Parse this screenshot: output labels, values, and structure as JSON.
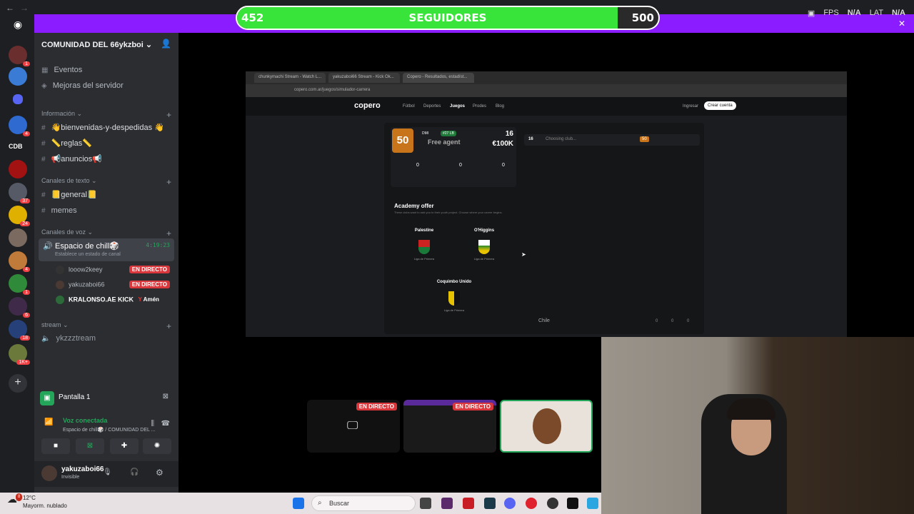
{
  "overlay": {
    "followers_current": "452",
    "followers_label": "SEGUIDORES",
    "followers_goal": "500",
    "progress": 0.904,
    "fps_label": "FPS",
    "fps_value": "N/A",
    "lat_label": "LAT",
    "lat_value": "N/A"
  },
  "rail": {
    "badges": [
      "1",
      "4",
      "37",
      "24",
      "4",
      "1",
      "6",
      "18",
      "1K+"
    ],
    "text_server": "CDB"
  },
  "sidebar": {
    "server_name": "COMUNIDAD DEL 66ykzboi",
    "events": "Eventos",
    "boosts": "Mejoras del servidor",
    "cat_info": "Información",
    "channels_info": [
      "👋bienvenidas-y-despedidas 👋",
      "📏reglas📏",
      "📢anuncios📢"
    ],
    "cat_text": "Canales de texto",
    "channels_text": [
      "📒general📒",
      "memes"
    ],
    "cat_voice": "Canales de voz",
    "voice_channel": "Espacio de chill🎲",
    "voice_time": "4:19:23",
    "voice_status_hint": "Establece un estado de canal",
    "voice_users": [
      {
        "name": "looow2keey",
        "live": "EN DIRECTO"
      },
      {
        "name": "yakuzaboi66",
        "live": "EN DIRECTO"
      },
      {
        "name": "KRALONSO.AE KICK",
        "status": "Amén"
      }
    ],
    "cat_stream": "stream",
    "stream_channel": "ykzzztream",
    "pantalla": "Pantalla 1",
    "voice_connected": "Voz conectada",
    "voice_connected_sub": "Espacio de chill🎲 / COMUNIDAD DEL ...",
    "user_name": "yakuzaboi66",
    "user_status": "Invisible"
  },
  "stream": {
    "tabs": [
      "chunkymachi Stream - Watch L...",
      "yakuzaboi66 Stream - Kick Ok...",
      "Copero - Resultados, estadíst..."
    ],
    "url": "copero.com.ar/juegos/simulador-carrera",
    "site_name": "copero",
    "nav": [
      "Fútbol",
      "Deportes",
      "Juegos",
      "Prodes",
      "Blog"
    ],
    "login": "Ingresar",
    "signup": "Crear cuenta",
    "rating": "50",
    "position": "DMI",
    "age_badge": "#27 LB",
    "free_agent": "Free agent",
    "age": "16",
    "value": "€100K",
    "stats": [
      "0",
      "0",
      "0"
    ],
    "academy_title": "Academy offer",
    "academy_sub": "These clubs want to add you to their youth project. Choose where your career begins.",
    "clubs": [
      "Palestine",
      "O'Higgins",
      "Coquimbo Unido"
    ],
    "club_league": "Liga de Primera",
    "season_age": "16",
    "choosing": "Choosing club...",
    "season_rating": "50",
    "country": "Chile",
    "totals": [
      "0",
      "0",
      "0"
    ]
  },
  "thumbs": {
    "live1": "EN DIRECTO",
    "live2": "EN DIRECTO"
  },
  "taskbar": {
    "weather_temp": "12°C",
    "weather_desc": "Mayorm. nublado",
    "search": "Buscar",
    "notif": "8"
  }
}
